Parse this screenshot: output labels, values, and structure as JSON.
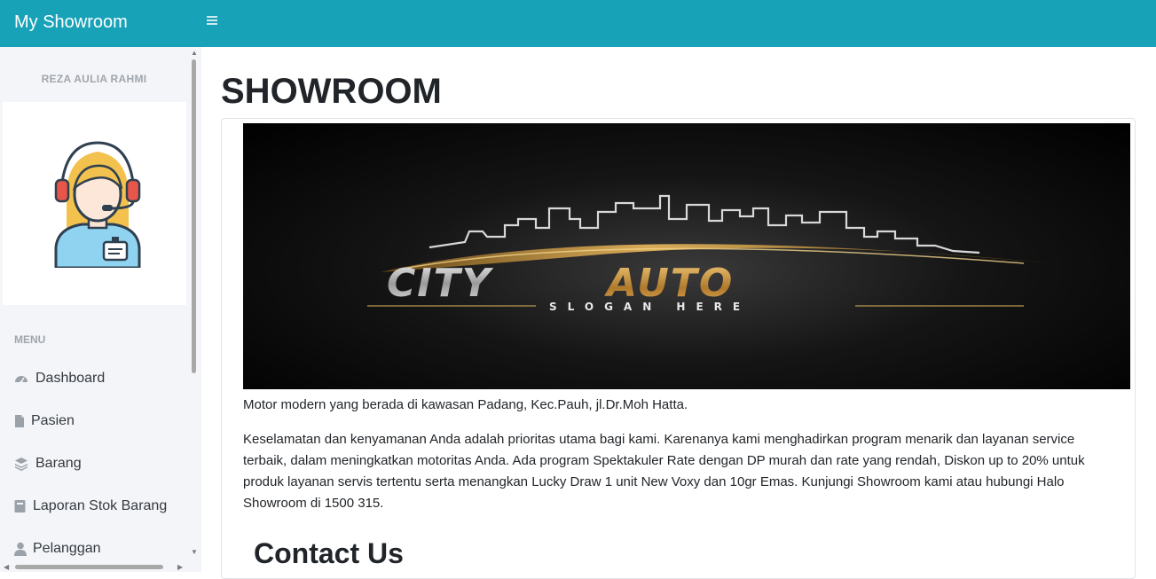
{
  "app": {
    "brand": "My Showroom"
  },
  "sidebar": {
    "user_name": "REZA AULIA RAHMI",
    "menu_heading": "MENU",
    "items": [
      {
        "label": "Dashboard",
        "icon": "dashboard-icon"
      },
      {
        "label": "Pasien",
        "icon": "file-icon"
      },
      {
        "label": "Barang",
        "icon": "layers-icon"
      },
      {
        "label": "Laporan Stok Barang",
        "icon": "book-icon"
      },
      {
        "label": "Pelanggan",
        "icon": "user-icon"
      }
    ]
  },
  "main": {
    "title": "SHOWROOM",
    "banner": {
      "logo_text": "CITYAUTO",
      "slogan": "SLOGAN HERE"
    },
    "paragraph1": "Motor modern yang berada di kawasan Padang, Kec.Pauh, jl.Dr.Moh Hatta.",
    "paragraph2": "Keselamatan dan kenyamanan Anda adalah prioritas utama bagi kami. Karenanya kami menghadirkan program menarik dan layanan service terbaik, dalam meningkatkan motoritas Anda. Ada program Spektakuler Rate dengan DP murah dan rate yang rendah, Diskon up to 20% untuk produk layanan servis tertentu serta menangkan Lucky Draw 1 unit New Voxy dan 10gr Emas. Kunjungi Showroom kami atau hubungi Halo Showroom di 1500 315.",
    "contact_heading": "Contact Us"
  },
  "colors": {
    "topbar": "#17a2b8",
    "sidebar": "#f4f5f8",
    "gold": "#d9a441"
  }
}
